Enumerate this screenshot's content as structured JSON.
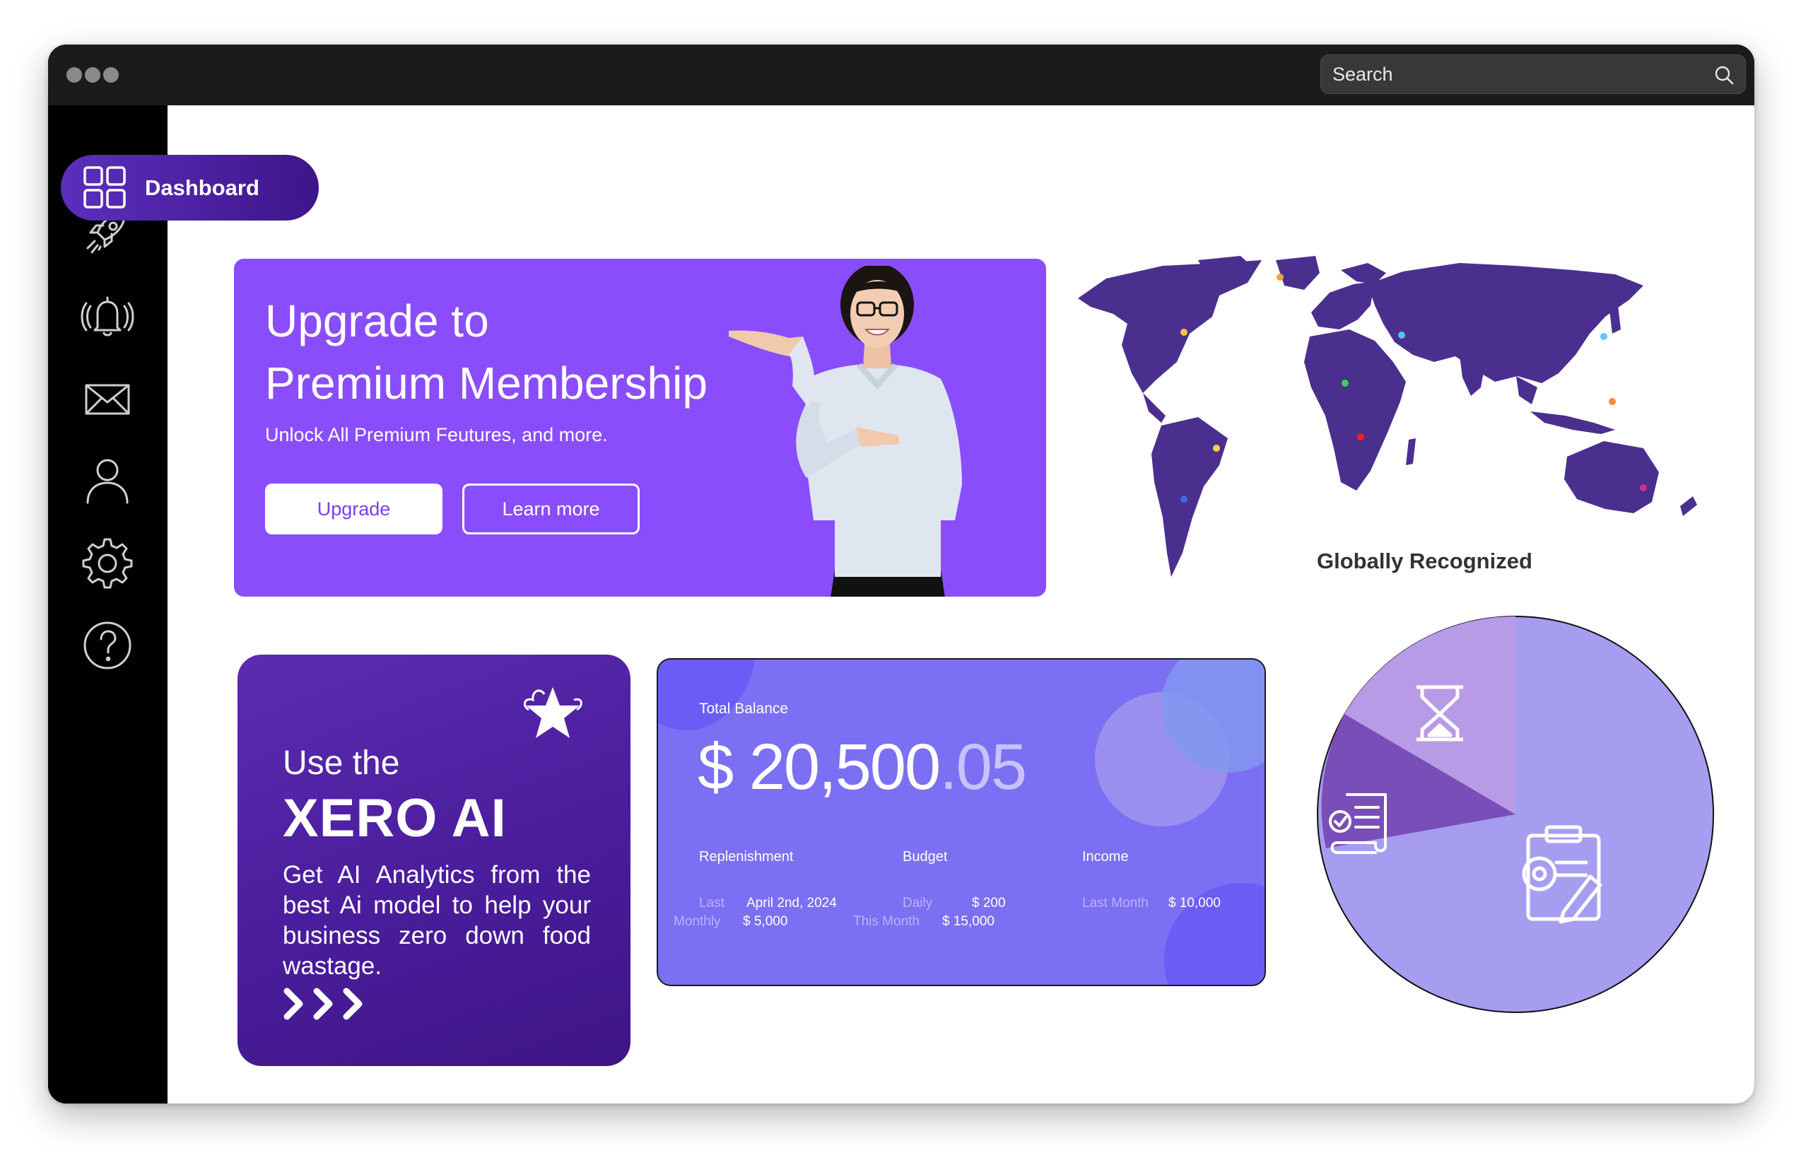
{
  "search": {
    "placeholder": "Search"
  },
  "sidebar": {
    "items": [
      {
        "icon": "rocket-icon"
      },
      {
        "icon": "bell-icon"
      },
      {
        "icon": "mail-icon"
      },
      {
        "icon": "user-icon"
      },
      {
        "icon": "gear-icon"
      },
      {
        "icon": "help-icon"
      }
    ]
  },
  "dashboard": {
    "label": "Dashboard",
    "icon": "grid-icon"
  },
  "upgrade": {
    "title_line1": "Upgrade to",
    "title_line2": "Premium Membership",
    "subtitle": "Unlock All Premium Feutures, and more.",
    "upgrade_label": "Upgrade",
    "learn_label": "Learn more"
  },
  "map": {
    "caption": "Globally Recognized"
  },
  "xero": {
    "intro": "Use the",
    "title": "XERO AI",
    "description": "Get AI Analytics from the best Ai model to help your business zero down food wastage."
  },
  "balance": {
    "label": "Total Balance",
    "amount_main": "$ 20,500",
    "amount_cents": ".05",
    "columns": [
      {
        "title": "Replenishment",
        "label1": "Last",
        "value1": "April 2nd, 2024",
        "label2": "Monthly",
        "value2": "$ 5,000"
      },
      {
        "title": "Budget",
        "label1": "Daily",
        "value1": "$ 200",
        "label2": "This Month",
        "value2": "$ 15,000"
      },
      {
        "title": "Income",
        "label1": "Last Month",
        "value1": "$ 10,000",
        "label2": "",
        "value2": ""
      }
    ]
  },
  "colors": {
    "accent": "#8a4dfb",
    "dark_purple": "#4a1d9c",
    "balance_bg": "#7b6ff3",
    "map_fill": "#4b2f8f",
    "pie_main": "#a79df0",
    "pie_light": "#b89be6",
    "pie_dark": "#7a4eb8"
  }
}
